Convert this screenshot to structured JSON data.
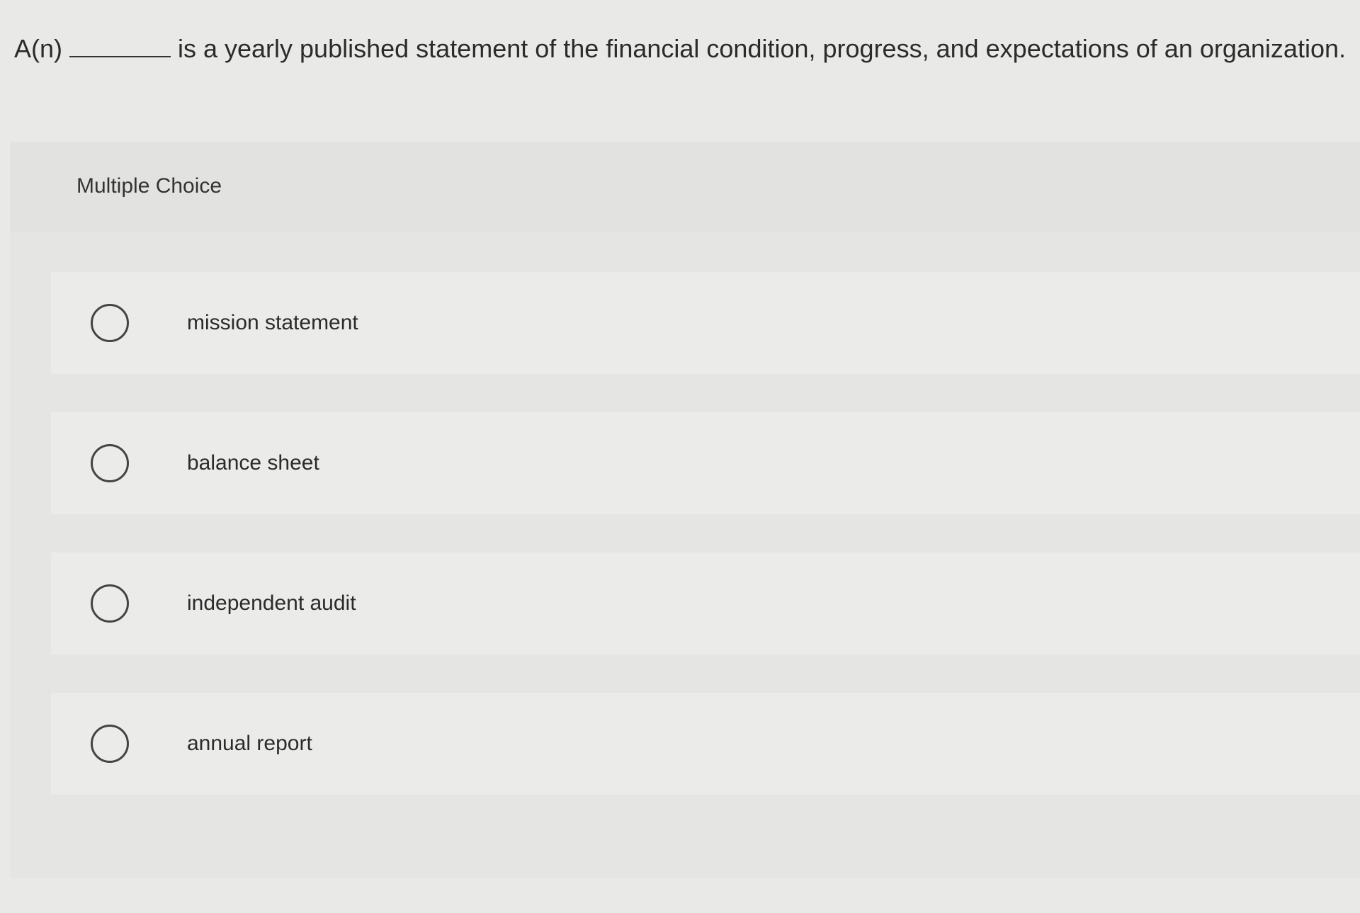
{
  "question": {
    "prefix": "A(n)",
    "stem": "is a yearly published statement of the financial condition, progress, and expectations of an organization."
  },
  "panel": {
    "header": "Multiple Choice"
  },
  "options": [
    {
      "label": "mission statement"
    },
    {
      "label": "balance sheet"
    },
    {
      "label": "independent audit"
    },
    {
      "label": "annual report"
    }
  ]
}
